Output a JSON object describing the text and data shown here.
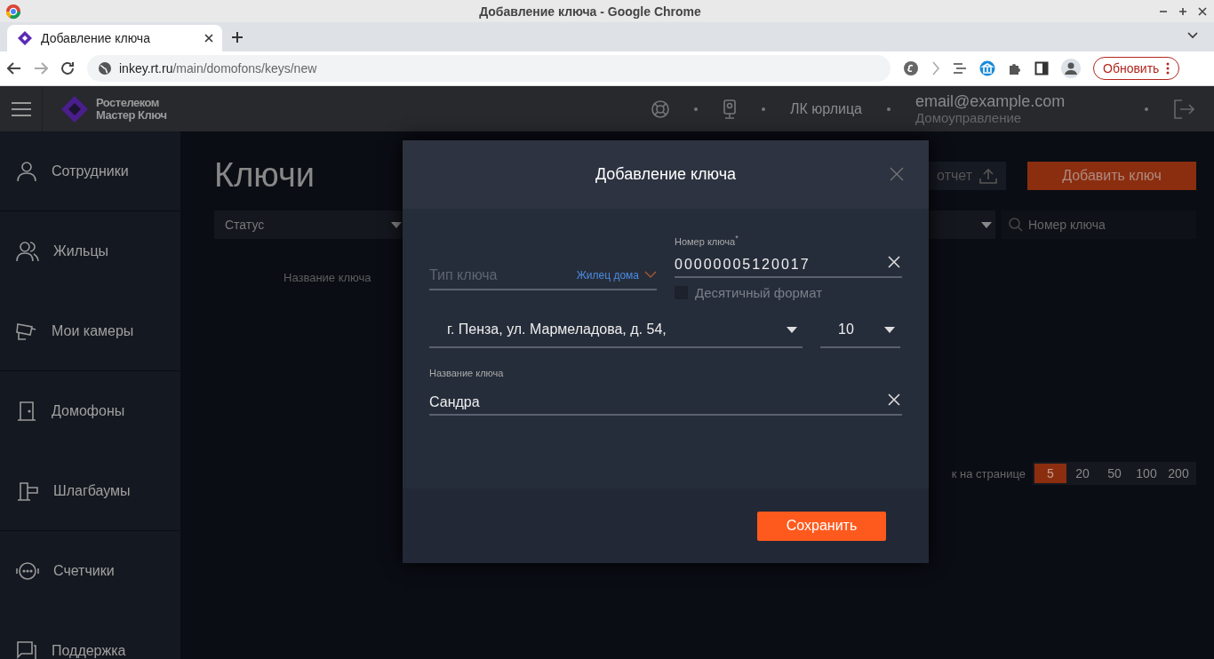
{
  "browser": {
    "window_title": "Добавление ключа - Google Chrome",
    "tab": {
      "title": "Добавление ключа"
    },
    "url_host": "inkey.rt.ru",
    "url_path": "/main/domofons/keys/new",
    "update_button": "Обновить"
  },
  "header": {
    "brand_line1": "Ростелеком",
    "brand_line2": "Мастер Ключ",
    "account": "ЛК юрлица",
    "email": "email@example.com",
    "organization": "Домоуправление"
  },
  "sidebar": {
    "items": [
      {
        "label": "Сотрудники",
        "kind": "person"
      },
      {
        "label": "Жильцы",
        "kind": "people"
      },
      {
        "label": "Мои камеры",
        "kind": "camera"
      },
      {
        "label": "Домофоны",
        "kind": "door"
      },
      {
        "label": "Шлагбаумы",
        "kind": "barrier"
      },
      {
        "label": "Счетчики",
        "kind": "meter"
      },
      {
        "label": "Поддержка",
        "kind": "chat"
      }
    ]
  },
  "page": {
    "title": "Ключи",
    "status_filter": {
      "placeholder": "Статус"
    },
    "report_button": "отчет",
    "add_button": "Добавить ключ",
    "search": {
      "placeholder": "Номер ключа"
    },
    "columns": [
      "Название ключа"
    ],
    "per_page_label": "к на странице",
    "page_sizes": [
      {
        "label": "5",
        "selected": true
      },
      {
        "label": "20",
        "selected": false
      },
      {
        "label": "50",
        "selected": false
      },
      {
        "label": "100",
        "selected": false
      },
      {
        "label": "200",
        "selected": false
      }
    ]
  },
  "dialog": {
    "title": "Добавление ключа",
    "key_type": {
      "label": "Тип ключа",
      "value": "Жилец дома"
    },
    "key_number": {
      "label": "Номер ключа$^{*}$",
      "value": "00000005120017"
    },
    "decimal_format": {
      "label": "Десятичный формат",
      "checked": false
    },
    "address": {
      "value": "г. Пенза, ул. Мармеладова, д. 54,"
    },
    "apartment": {
      "value": "10"
    },
    "key_name": {
      "label": "Название ключа",
      "value": "Сандра"
    },
    "save_button": "Сохранить"
  }
}
